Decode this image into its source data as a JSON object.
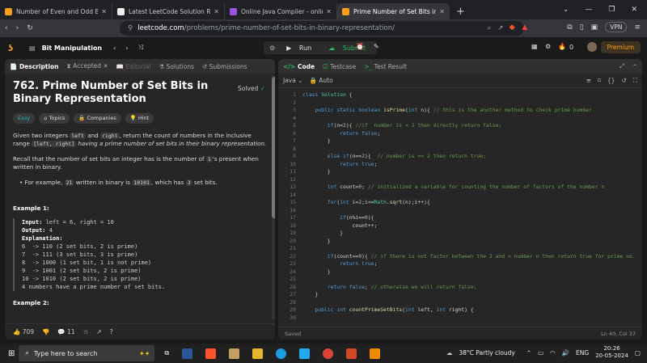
{
  "browser": {
    "tabs": [
      {
        "label": "Number of Even and Odd Bits - Leet",
        "color": "#f89f1b"
      },
      {
        "label": "Latest LeetCode Solution Reviewed",
        "color": "#eeeeee"
      },
      {
        "label": "Online Java Compiler - online editor",
        "color": "#9b51e0"
      },
      {
        "label": "Prime Number of Set Bits in Bin",
        "color": "#f89f1b"
      }
    ],
    "url_domain": "leetcode.com",
    "url_path": "/problems/prime-number-of-set-bits-in-binary-representation/",
    "vpn": "VPN"
  },
  "header": {
    "list_name": "Bit Manipulation",
    "run": "Run",
    "submit": "Submit",
    "streak": "0",
    "premium": "Premium"
  },
  "left_tabs": [
    "Description",
    "Accepted",
    "Editorial",
    "Solutions",
    "Submissions"
  ],
  "problem": {
    "title": "762. Prime Number of Set Bits in Binary Representation",
    "status": "Solved",
    "tags": [
      "Easy",
      "Topics",
      "Companies",
      "Hint"
    ],
    "p1a": "Given two integers",
    "p1_code1": "left",
    "p1b": "and",
    "p1_code2": "right",
    "p1c": ", return the count of numbers in the inclusive range",
    "p1_code3": "[left, right]",
    "p1d": "having a prime number of set bits in their binary representation.",
    "p2a": "Recall that the number of set bits an integer has is the number of",
    "p2_code": "1",
    "p2b": "'s present when written in binary.",
    "bullet_a": "For example,",
    "bullet_code1": "21",
    "bullet_b": "written in binary is",
    "bullet_code2": "10101",
    "bullet_c": ", which has",
    "bullet_code3": "3",
    "bullet_d": "set bits.",
    "example1_title": "Example 1:",
    "example1_input_label": "Input:",
    "example1_input": " left = 6, right = 10",
    "example1_output_label": "Output:",
    "example1_output": " 4",
    "example1_expl_label": "Explanation:",
    "example1_lines": "6  -> 110 (2 set bits, 2 is prime)\n7  -> 111 (3 set bits, 3 is prime)\n8  -> 1000 (1 set bit, 1 is not prime)\n9  -> 1001 (2 set bits, 2 is prime)\n10 -> 1010 (2 set bits, 2 is prime)\n4 numbers have a prime number of set bits.",
    "example2_title": "Example 2:",
    "likes": "709",
    "comments": "11"
  },
  "right_tabs": [
    "Code",
    "Testcase",
    "Test Result"
  ],
  "editor": {
    "language": "Java",
    "mode": "Auto",
    "status_left": "Saved",
    "status_right": "Ln 40, Col 37"
  },
  "taskbar": {
    "search": "Type here to search",
    "weather": "38°C  Partly cloudy",
    "lang": "ENG",
    "time": "20:26",
    "date": "20-05-2024"
  }
}
